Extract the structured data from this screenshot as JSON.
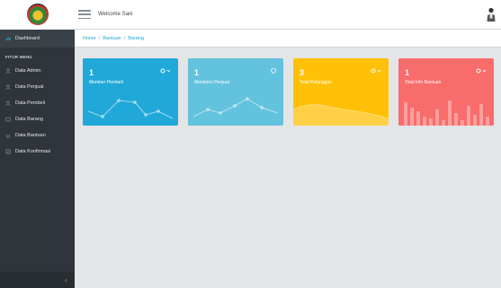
{
  "header": {
    "welcome_text": "Welcome Sani"
  },
  "breadcrumb": {
    "items": [
      "Home",
      "Bantuan",
      "Barang"
    ],
    "separator": "/"
  },
  "sidebar": {
    "dashboard_label": "Dashboard",
    "section_title": "FITUR MENU",
    "items": [
      {
        "label": "Data Admin",
        "icon": "user-icon"
      },
      {
        "label": "Data Penjual",
        "icon": "user-icon"
      },
      {
        "label": "Data Pembeli",
        "icon": "user-icon"
      },
      {
        "label": "Data Barang",
        "icon": "box-icon"
      },
      {
        "label": "Data Bantuan",
        "icon": "help-icon"
      },
      {
        "label": "Data Konfirmasi",
        "icon": "check-icon"
      }
    ],
    "collapse_glyph": "‹"
  },
  "cards": [
    {
      "count": "1",
      "label": "Member Pembeli",
      "color": "#20a8d8",
      "chart": "line"
    },
    {
      "count": "1",
      "label": "Members Penjual",
      "color": "#63c2de",
      "chart": "line"
    },
    {
      "count": "3",
      "label": "Total Pelanggan",
      "color": "#ffc107",
      "chart": "area"
    },
    {
      "count": "1",
      "label": "Total Info Bantuan",
      "color": "#f86c6b",
      "chart": "bar"
    }
  ],
  "colors": {
    "sidebar_bg": "#2f353a",
    "accent": "#20a8d8",
    "page_bg": "#e4e5e6"
  }
}
